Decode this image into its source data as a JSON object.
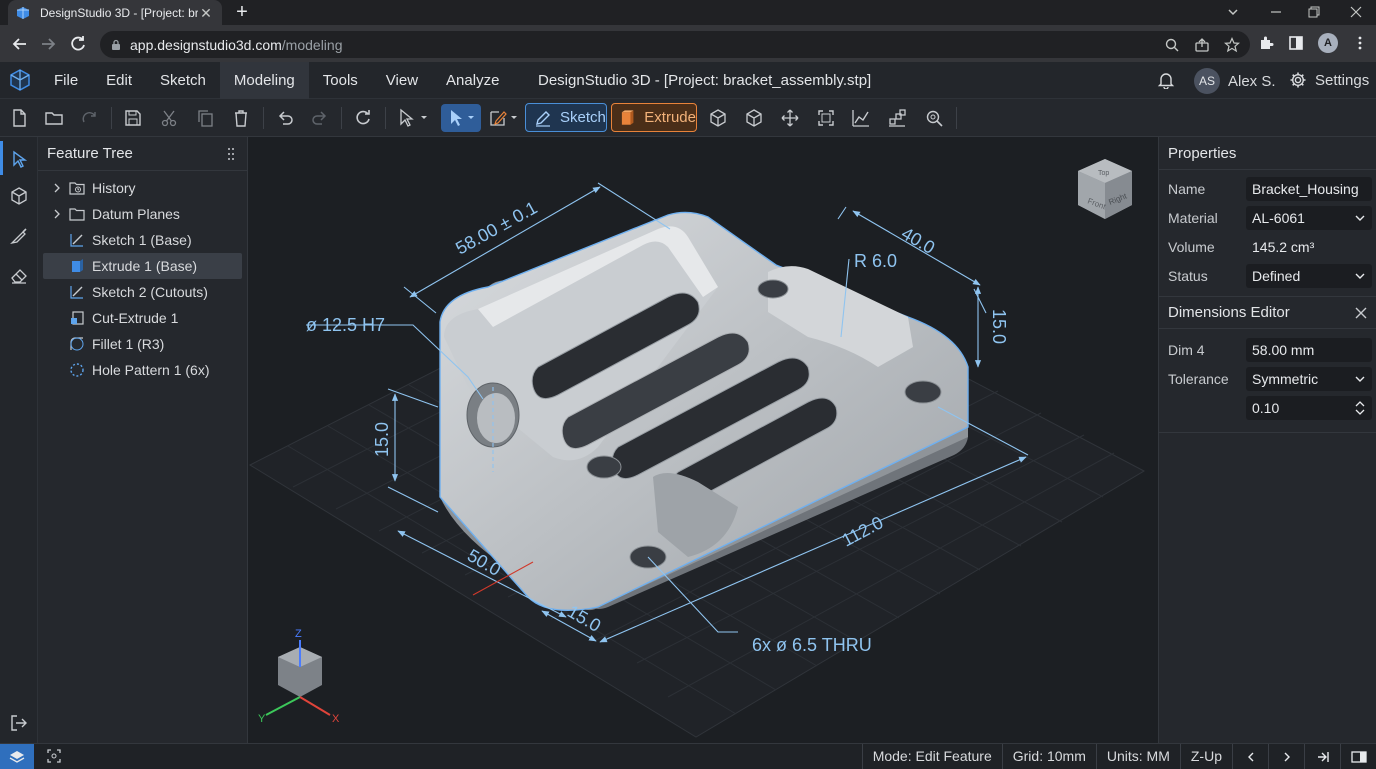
{
  "browser": {
    "tab_title": "DesignStudio 3D - [Project: bracket_assembly.stp]",
    "url_host": "app.designstudio3d.com",
    "url_path": "/modeling",
    "profile_initial": "A"
  },
  "app": {
    "menus": [
      "File",
      "Edit",
      "Sketch",
      "Modeling",
      "Tools",
      "View",
      "Analyze"
    ],
    "active_menu": "Modeling",
    "window_title": "DesignStudio 3D - [Project: bracket_assembly.stp]",
    "user_initials": "AS",
    "user_name": "Alex S.",
    "settings_label": "Settings"
  },
  "toolbar": {
    "sketch_label": "Sketch",
    "extrude_label": "Extrude"
  },
  "feature_tree": {
    "title": "Feature Tree",
    "items": [
      {
        "label": "History",
        "icon": "history-folder-icon",
        "expandable": true
      },
      {
        "label": "Datum Planes",
        "icon": "folder-icon",
        "expandable": true
      },
      {
        "label": "Sketch 1 (Base)",
        "icon": "sketch-icon",
        "expandable": false
      },
      {
        "label": "Extrude 1 (Base)",
        "icon": "extrude-icon",
        "expandable": false,
        "selected": true
      },
      {
        "label": "Sketch 2 (Cutouts)",
        "icon": "sketch-icon",
        "expandable": false
      },
      {
        "label": "Cut-Extrude 1",
        "icon": "cut-extrude-icon",
        "expandable": false
      },
      {
        "label": "Fillet 1 (R3)",
        "icon": "fillet-icon",
        "expandable": false
      },
      {
        "label": "Hole Pattern 1 (6x)",
        "icon": "hole-pattern-icon",
        "expandable": false
      }
    ]
  },
  "viewport": {
    "dimensions": {
      "overall_width": "58.00 ± 0.1",
      "depth_40": "40.0",
      "radius": "R 6.0",
      "boss_dia": "ø 12.5 H7",
      "height_right": "15.0",
      "height_left": "15.0",
      "length": "112.0",
      "offset_50": "50.0",
      "offset_15": "15.0",
      "holes": "6x ø 6.5 THRU"
    },
    "viewcube": {
      "front": "Front",
      "right": "Right",
      "top": "Top"
    },
    "axes": {
      "x": "X",
      "y": "Y",
      "z": "Z"
    }
  },
  "properties": {
    "title": "Properties",
    "name_label": "Name",
    "name_value": "Bracket_Housing",
    "material_label": "Material",
    "material_value": "AL-6061",
    "volume_label": "Volume",
    "volume_value": "145.2 cm³",
    "status_label": "Status",
    "status_value": "Defined"
  },
  "dimensions_editor": {
    "title": "Dimensions Editor",
    "dim_label": "Dim 4",
    "dim_value": "58.00 mm",
    "tolerance_label": "Tolerance",
    "tolerance_value": "Symmetric",
    "tol_amount": "0.10"
  },
  "statusbar": {
    "mode": "Mode: Edit Feature",
    "grid": "Grid: 10mm",
    "units": "Units: MM",
    "up": "Z-Up"
  },
  "colors": {
    "accent": "#3f8ce6",
    "extrude_orange": "#e8833a",
    "dimension_blue": "#8fc4f0"
  }
}
